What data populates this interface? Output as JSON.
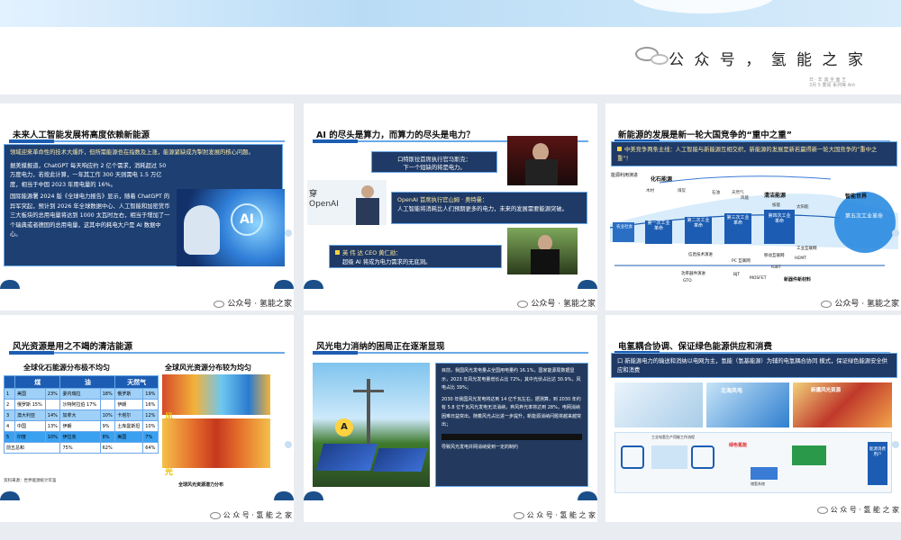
{
  "header": {
    "watermark_text": "公 众 号 ， 氢 能 之 家",
    "stamp_line1": "日  · 非 诚 全 面 王",
    "stamp_line2": "3月 5 要闻 系列等 Ant"
  },
  "footer": {
    "text": "公众号 · 氢能之家",
    "text_spaced": "公 众 号 · 氢 能 之 家"
  },
  "slides": [
    {
      "title": "未来人工智能发展将高度依赖新能源",
      "intro": "领域迎来革命性的技术大爆炸，但所需能源也在指数及上涨，能源紧缺成为掣肘发展的核心问题。",
      "p1": "据美媒报道，ChatGPT 每天响应约 2 亿个需求，消耗超过 50 万度电力，若按此计算，一年其工作 300 天则需电 1.5 万亿度，相当于中国 2023 年用电量的 16%。",
      "p2": "国际能源署 2024 版《全球电力报告》显示，随着 ChatGPT 的异军突起，预计到 2026 年全球数据中心、人工智能和加密货币三大板块的总用电量将达到 1000 太瓦时左右，相当于增加了一个瑞典或者德国的总用电量，这其中的耗电大户是 AI 数据中心。",
      "ai_label": "AI"
    },
    {
      "title": "AI 的尽头是算力，而算力的尽头是电力？",
      "q1_label": "口特斯拉首席执行官马斯克：",
      "q1_text": "下一个短缺的将是电力。",
      "openai_label": "OpenAI",
      "openai_char": "穿",
      "q2_label": "OpenAI  首席执行官山姆 · 奥特曼：",
      "q2_text": "人工智能将消耗比人们预期更多的电力，未来的发展需要能源突破。",
      "q3_label": "英 伟 达 CEO  黄仁勋：",
      "q3_text": "超级 AI 将成为电力需求的无底洞。"
    },
    {
      "title": "新能源的发展是新一轮大国竞争的“重中之重”",
      "intro": "中美竞争两条主线：人工智能与新能源互相交织，新能源的发展是新若赢得新一轮大国竞争的“重中之重”！",
      "labels": {
        "energy_use": "能源利用演进",
        "fossil": "化石能源",
        "clean": "清洁能源",
        "smart_world": "智能世界",
        "nuclear": "核能",
        "solar": "太阳能",
        "wood": "木材",
        "coal": "煤炭",
        "oil": "石油",
        "natgas": "天然气",
        "wind": "风能",
        "agri": "农业社会",
        "info_tech": "信息技术演进",
        "pc_internet": "PC 互联网",
        "mobile_internet": "移动互联网",
        "industrial_internet": "工业互联网",
        "power_device": "功率器件演进",
        "gto": "GTO",
        "bjt": "BJT",
        "mosfet": "MOSFET",
        "igbt": "IGBT",
        "new_device": "新器件新材料",
        "hemt": "HEMT",
        "ev1": "第一次工业革命",
        "ev2": "第二次工业革命",
        "ev3": "第三次工业革命",
        "ev4": "第四次工业革命",
        "ev5": "第五次工业革命"
      }
    },
    {
      "title": "风光资源是用之不竭的清洁能源",
      "sub_left": "全球化石能源分布极不均匀",
      "sub_right": "全球风光资源分布较为均匀",
      "cols": [
        "煤",
        "油",
        "天然气"
      ],
      "rows": [
        [
          "1",
          "美国",
          "23%",
          "委内瑞拉",
          "18%",
          "俄罗斯",
          "19%"
        ],
        [
          "2",
          "俄罗斯 15%",
          "",
          "沙特阿拉伯 17%",
          "",
          "伊朗",
          "16%"
        ],
        [
          "3",
          "澳大利亚",
          "14%",
          "加拿大",
          "10%",
          "卡塔尔",
          "12%"
        ],
        [
          "4",
          "中国",
          "13%",
          "伊朗",
          "9%",
          "土库曼斯坦",
          "10%"
        ],
        [
          "5",
          "印度",
          "10%",
          "伊拉克",
          "8%",
          "美国",
          "7%"
        ]
      ],
      "total": [
        "前五总和",
        "75%",
        "62%",
        "64%"
      ],
      "source": "资料来源：世界能源统计年鉴",
      "map_label_wind": "风",
      "map_label_light": "光",
      "map_caption": "全球风光资源潜力分布"
    },
    {
      "title": "风光电力消纳的困局正在逐渐显现",
      "text1": "目前，我国风光发电量占全国用电量约 16.1%，国家能源局数据显示，2023 年风光发电量增长占比 72%，其中光伏占比达 30.9%，风电占比 39%；",
      "text2": "2030 年我国风光发电将达到 14 亿千瓦左右，据测算，到 2030 年约有 5.8 亿千瓦风光发电无法消纳，弃风弃光率将达到 28%，电网消纳困难日益突出，随着风光占比进一步提升，新能源消纳问题将越来越突出；",
      "text3": "导致风光发电并网消纳受到一定的制约"
    },
    {
      "title": "电氢耦合协调、保证绿色能源供应和消费",
      "intro": "口 新能源电力的输送和消纳以电网为主，氢能（氢基能源）为辅的电氢耦合协同 模式，保证绿色能源安全供应和消费",
      "map_label_sea": "北海风电",
      "map_label_wind": "新疆风光资源",
      "diagram_title": "工业电氢生产用能工作流程",
      "label_green": "绿色氢能",
      "label_users": "能源消费用户",
      "label_storage": "储氢系统"
    }
  ]
}
